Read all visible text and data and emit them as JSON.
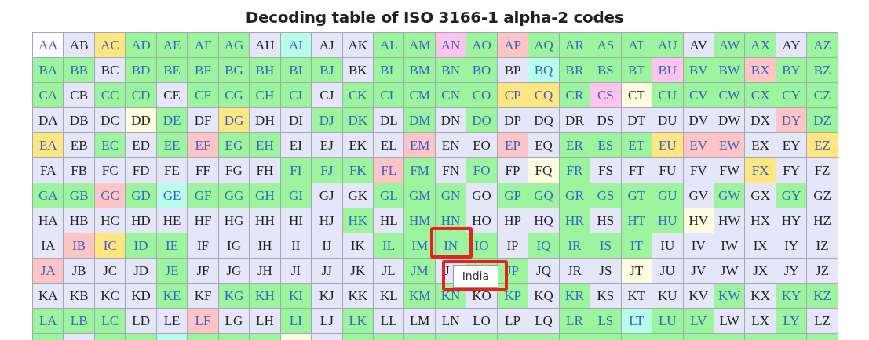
{
  "title": "Decoding table of ISO 3166-1 alpha-2 codes",
  "rows": [
    {
      "cells": [
        {
          "code": "AA",
          "kind": "w"
        },
        {
          "code": "AB",
          "kind": "u"
        },
        {
          "code": "AC",
          "kind": "y"
        },
        {
          "code": "AD",
          "kind": "g"
        },
        {
          "code": "AE",
          "kind": "g"
        },
        {
          "code": "AF",
          "kind": "g"
        },
        {
          "code": "AG",
          "kind": "g"
        },
        {
          "code": "AH",
          "kind": "u"
        },
        {
          "code": "AI",
          "kind": "c"
        },
        {
          "code": "AJ",
          "kind": "u"
        },
        {
          "code": "AK",
          "kind": "u"
        },
        {
          "code": "AL",
          "kind": "g"
        },
        {
          "code": "AM",
          "kind": "g"
        },
        {
          "code": "AN",
          "kind": "m"
        },
        {
          "code": "AO",
          "kind": "g"
        },
        {
          "code": "AP",
          "kind": "p"
        },
        {
          "code": "AQ",
          "kind": "g"
        },
        {
          "code": "AR",
          "kind": "g"
        },
        {
          "code": "AS",
          "kind": "g"
        },
        {
          "code": "AT",
          "kind": "g"
        },
        {
          "code": "AU",
          "kind": "g"
        },
        {
          "code": "AV",
          "kind": "u"
        },
        {
          "code": "AW",
          "kind": "g"
        },
        {
          "code": "AX",
          "kind": "g"
        },
        {
          "code": "AY",
          "kind": "u"
        },
        {
          "code": "AZ",
          "kind": "g"
        }
      ]
    },
    {
      "cells": [
        {
          "code": "BA",
          "kind": "g"
        },
        {
          "code": "BB",
          "kind": "g"
        },
        {
          "code": "BC",
          "kind": "u"
        },
        {
          "code": "BD",
          "kind": "g"
        },
        {
          "code": "BE",
          "kind": "g"
        },
        {
          "code": "BF",
          "kind": "g"
        },
        {
          "code": "BG",
          "kind": "g"
        },
        {
          "code": "BH",
          "kind": "g"
        },
        {
          "code": "BI",
          "kind": "g"
        },
        {
          "code": "BJ",
          "kind": "g"
        },
        {
          "code": "BK",
          "kind": "u"
        },
        {
          "code": "BL",
          "kind": "g"
        },
        {
          "code": "BM",
          "kind": "g"
        },
        {
          "code": "BN",
          "kind": "g"
        },
        {
          "code": "BO",
          "kind": "g"
        },
        {
          "code": "BP",
          "kind": "u"
        },
        {
          "code": "BQ",
          "kind": "c"
        },
        {
          "code": "BR",
          "kind": "g"
        },
        {
          "code": "BS",
          "kind": "g"
        },
        {
          "code": "BT",
          "kind": "g"
        },
        {
          "code": "BU",
          "kind": "m"
        },
        {
          "code": "BV",
          "kind": "g"
        },
        {
          "code": "BW",
          "kind": "g"
        },
        {
          "code": "BX",
          "kind": "p"
        },
        {
          "code": "BY",
          "kind": "g"
        },
        {
          "code": "BZ",
          "kind": "g"
        }
      ]
    },
    {
      "cells": [
        {
          "code": "CA",
          "kind": "g"
        },
        {
          "code": "CB",
          "kind": "u"
        },
        {
          "code": "CC",
          "kind": "g"
        },
        {
          "code": "CD",
          "kind": "g"
        },
        {
          "code": "CE",
          "kind": "u"
        },
        {
          "code": "CF",
          "kind": "g"
        },
        {
          "code": "CG",
          "kind": "g"
        },
        {
          "code": "CH",
          "kind": "g"
        },
        {
          "code": "CI",
          "kind": "g"
        },
        {
          "code": "CJ",
          "kind": "u"
        },
        {
          "code": "CK",
          "kind": "g"
        },
        {
          "code": "CL",
          "kind": "g"
        },
        {
          "code": "CM",
          "kind": "g"
        },
        {
          "code": "CN",
          "kind": "g"
        },
        {
          "code": "CO",
          "kind": "g"
        },
        {
          "code": "CP",
          "kind": "y"
        },
        {
          "code": "CQ",
          "kind": "y"
        },
        {
          "code": "CR",
          "kind": "g"
        },
        {
          "code": "CS",
          "kind": "m"
        },
        {
          "code": "CT",
          "kind": "l"
        },
        {
          "code": "CU",
          "kind": "g"
        },
        {
          "code": "CV",
          "kind": "g"
        },
        {
          "code": "CW",
          "kind": "g"
        },
        {
          "code": "CX",
          "kind": "g"
        },
        {
          "code": "CY",
          "kind": "g"
        },
        {
          "code": "CZ",
          "kind": "g"
        }
      ]
    },
    {
      "cells": [
        {
          "code": "DA",
          "kind": "u"
        },
        {
          "code": "DB",
          "kind": "u"
        },
        {
          "code": "DC",
          "kind": "u"
        },
        {
          "code": "DD",
          "kind": "l"
        },
        {
          "code": "DE",
          "kind": "g"
        },
        {
          "code": "DF",
          "kind": "u"
        },
        {
          "code": "DG",
          "kind": "y"
        },
        {
          "code": "DH",
          "kind": "u"
        },
        {
          "code": "DI",
          "kind": "u"
        },
        {
          "code": "DJ",
          "kind": "g"
        },
        {
          "code": "DK",
          "kind": "g"
        },
        {
          "code": "DL",
          "kind": "u"
        },
        {
          "code": "DM",
          "kind": "g"
        },
        {
          "code": "DN",
          "kind": "u"
        },
        {
          "code": "DO",
          "kind": "g"
        },
        {
          "code": "DP",
          "kind": "u"
        },
        {
          "code": "DQ",
          "kind": "u"
        },
        {
          "code": "DR",
          "kind": "u"
        },
        {
          "code": "DS",
          "kind": "u"
        },
        {
          "code": "DT",
          "kind": "u"
        },
        {
          "code": "DU",
          "kind": "u"
        },
        {
          "code": "DV",
          "kind": "u"
        },
        {
          "code": "DW",
          "kind": "u"
        },
        {
          "code": "DX",
          "kind": "u"
        },
        {
          "code": "DY",
          "kind": "p"
        },
        {
          "code": "DZ",
          "kind": "g"
        }
      ]
    },
    {
      "cells": [
        {
          "code": "EA",
          "kind": "y"
        },
        {
          "code": "EB",
          "kind": "u"
        },
        {
          "code": "EC",
          "kind": "g"
        },
        {
          "code": "ED",
          "kind": "u"
        },
        {
          "code": "EE",
          "kind": "g"
        },
        {
          "code": "EF",
          "kind": "p"
        },
        {
          "code": "EG",
          "kind": "g"
        },
        {
          "code": "EH",
          "kind": "g"
        },
        {
          "code": "EI",
          "kind": "u"
        },
        {
          "code": "EJ",
          "kind": "u"
        },
        {
          "code": "EK",
          "kind": "u"
        },
        {
          "code": "EL",
          "kind": "u"
        },
        {
          "code": "EM",
          "kind": "p"
        },
        {
          "code": "EN",
          "kind": "u"
        },
        {
          "code": "EO",
          "kind": "u"
        },
        {
          "code": "EP",
          "kind": "p"
        },
        {
          "code": "EQ",
          "kind": "u"
        },
        {
          "code": "ER",
          "kind": "g"
        },
        {
          "code": "ES",
          "kind": "g"
        },
        {
          "code": "ET",
          "kind": "g"
        },
        {
          "code": "EU",
          "kind": "y"
        },
        {
          "code": "EV",
          "kind": "p"
        },
        {
          "code": "EW",
          "kind": "p"
        },
        {
          "code": "EX",
          "kind": "u"
        },
        {
          "code": "EY",
          "kind": "u"
        },
        {
          "code": "EZ",
          "kind": "y"
        }
      ]
    },
    {
      "cells": [
        {
          "code": "FA",
          "kind": "u"
        },
        {
          "code": "FB",
          "kind": "u"
        },
        {
          "code": "FC",
          "kind": "u"
        },
        {
          "code": "FD",
          "kind": "u"
        },
        {
          "code": "FE",
          "kind": "u"
        },
        {
          "code": "FF",
          "kind": "u"
        },
        {
          "code": "FG",
          "kind": "u"
        },
        {
          "code": "FH",
          "kind": "u"
        },
        {
          "code": "FI",
          "kind": "g"
        },
        {
          "code": "FJ",
          "kind": "g"
        },
        {
          "code": "FK",
          "kind": "g"
        },
        {
          "code": "FL",
          "kind": "p"
        },
        {
          "code": "FM",
          "kind": "g"
        },
        {
          "code": "FN",
          "kind": "u"
        },
        {
          "code": "FO",
          "kind": "g"
        },
        {
          "code": "FP",
          "kind": "u"
        },
        {
          "code": "FQ",
          "kind": "l"
        },
        {
          "code": "FR",
          "kind": "g"
        },
        {
          "code": "FS",
          "kind": "u"
        },
        {
          "code": "FT",
          "kind": "u"
        },
        {
          "code": "FU",
          "kind": "u"
        },
        {
          "code": "FV",
          "kind": "u"
        },
        {
          "code": "FW",
          "kind": "u"
        },
        {
          "code": "FX",
          "kind": "y"
        },
        {
          "code": "FY",
          "kind": "u"
        },
        {
          "code": "FZ",
          "kind": "u"
        }
      ]
    },
    {
      "cells": [
        {
          "code": "GA",
          "kind": "g"
        },
        {
          "code": "GB",
          "kind": "g"
        },
        {
          "code": "GC",
          "kind": "p"
        },
        {
          "code": "GD",
          "kind": "g"
        },
        {
          "code": "GE",
          "kind": "c"
        },
        {
          "code": "GF",
          "kind": "g"
        },
        {
          "code": "GG",
          "kind": "g"
        },
        {
          "code": "GH",
          "kind": "g"
        },
        {
          "code": "GI",
          "kind": "g"
        },
        {
          "code": "GJ",
          "kind": "u"
        },
        {
          "code": "GK",
          "kind": "u"
        },
        {
          "code": "GL",
          "kind": "g"
        },
        {
          "code": "GM",
          "kind": "g"
        },
        {
          "code": "GN",
          "kind": "g"
        },
        {
          "code": "GO",
          "kind": "u"
        },
        {
          "code": "GP",
          "kind": "g"
        },
        {
          "code": "GQ",
          "kind": "g"
        },
        {
          "code": "GR",
          "kind": "g"
        },
        {
          "code": "GS",
          "kind": "g"
        },
        {
          "code": "GT",
          "kind": "g"
        },
        {
          "code": "GU",
          "kind": "g"
        },
        {
          "code": "GV",
          "kind": "u"
        },
        {
          "code": "GW",
          "kind": "g"
        },
        {
          "code": "GX",
          "kind": "u"
        },
        {
          "code": "GY",
          "kind": "g"
        },
        {
          "code": "GZ",
          "kind": "u"
        }
      ]
    },
    {
      "cells": [
        {
          "code": "HA",
          "kind": "u"
        },
        {
          "code": "HB",
          "kind": "u"
        },
        {
          "code": "HC",
          "kind": "u"
        },
        {
          "code": "HD",
          "kind": "u"
        },
        {
          "code": "HE",
          "kind": "u"
        },
        {
          "code": "HF",
          "kind": "u"
        },
        {
          "code": "HG",
          "kind": "u"
        },
        {
          "code": "HH",
          "kind": "u"
        },
        {
          "code": "HI",
          "kind": "u"
        },
        {
          "code": "HJ",
          "kind": "u"
        },
        {
          "code": "HK",
          "kind": "g"
        },
        {
          "code": "HL",
          "kind": "u"
        },
        {
          "code": "HM",
          "kind": "g"
        },
        {
          "code": "HN",
          "kind": "g"
        },
        {
          "code": "HO",
          "kind": "u"
        },
        {
          "code": "HP",
          "kind": "u"
        },
        {
          "code": "HQ",
          "kind": "u"
        },
        {
          "code": "HR",
          "kind": "g"
        },
        {
          "code": "HS",
          "kind": "u"
        },
        {
          "code": "HT",
          "kind": "g"
        },
        {
          "code": "HU",
          "kind": "g"
        },
        {
          "code": "HV",
          "kind": "l"
        },
        {
          "code": "HW",
          "kind": "u"
        },
        {
          "code": "HX",
          "kind": "u"
        },
        {
          "code": "HY",
          "kind": "u"
        },
        {
          "code": "HZ",
          "kind": "u"
        }
      ]
    },
    {
      "cells": [
        {
          "code": "IA",
          "kind": "u"
        },
        {
          "code": "IB",
          "kind": "p"
        },
        {
          "code": "IC",
          "kind": "y"
        },
        {
          "code": "ID",
          "kind": "g"
        },
        {
          "code": "IE",
          "kind": "g"
        },
        {
          "code": "IF",
          "kind": "u"
        },
        {
          "code": "IG",
          "kind": "u"
        },
        {
          "code": "IH",
          "kind": "u"
        },
        {
          "code": "II",
          "kind": "u"
        },
        {
          "code": "IJ",
          "kind": "u"
        },
        {
          "code": "IK",
          "kind": "u"
        },
        {
          "code": "IL",
          "kind": "g"
        },
        {
          "code": "IM",
          "kind": "g"
        },
        {
          "code": "IN",
          "kind": "g",
          "annotated": true,
          "tooltip": "India"
        },
        {
          "code": "IO",
          "kind": "g"
        },
        {
          "code": "IP",
          "kind": "u"
        },
        {
          "code": "IQ",
          "kind": "g"
        },
        {
          "code": "IR",
          "kind": "g"
        },
        {
          "code": "IS",
          "kind": "g"
        },
        {
          "code": "IT",
          "kind": "g"
        },
        {
          "code": "IU",
          "kind": "u"
        },
        {
          "code": "IV",
          "kind": "u"
        },
        {
          "code": "IW",
          "kind": "u"
        },
        {
          "code": "IX",
          "kind": "u"
        },
        {
          "code": "IY",
          "kind": "u"
        },
        {
          "code": "IZ",
          "kind": "u"
        }
      ]
    },
    {
      "cells": [
        {
          "code": "JA",
          "kind": "p"
        },
        {
          "code": "JB",
          "kind": "u"
        },
        {
          "code": "JC",
          "kind": "u"
        },
        {
          "code": "JD",
          "kind": "u"
        },
        {
          "code": "JE",
          "kind": "g"
        },
        {
          "code": "JF",
          "kind": "u"
        },
        {
          "code": "JG",
          "kind": "u"
        },
        {
          "code": "JH",
          "kind": "u"
        },
        {
          "code": "JI",
          "kind": "u"
        },
        {
          "code": "JJ",
          "kind": "u"
        },
        {
          "code": "JK",
          "kind": "u"
        },
        {
          "code": "JL",
          "kind": "u"
        },
        {
          "code": "JM",
          "kind": "g"
        },
        {
          "code": "J",
          "kind": "u",
          "partial": true
        },
        {
          "kind": "g"
        },
        {
          "code": "JP",
          "kind": "g"
        },
        {
          "code": "JQ",
          "kind": "u"
        },
        {
          "code": "JR",
          "kind": "u"
        },
        {
          "code": "JS",
          "kind": "u"
        },
        {
          "code": "JT",
          "kind": "l"
        },
        {
          "code": "JU",
          "kind": "u"
        },
        {
          "code": "JV",
          "kind": "u"
        },
        {
          "code": "JW",
          "kind": "u"
        },
        {
          "code": "JX",
          "kind": "u"
        },
        {
          "code": "JY",
          "kind": "u"
        },
        {
          "code": "JZ",
          "kind": "u"
        }
      ]
    },
    {
      "cells": [
        {
          "code": "KA",
          "kind": "u"
        },
        {
          "code": "KB",
          "kind": "u"
        },
        {
          "code": "KC",
          "kind": "u"
        },
        {
          "code": "KD",
          "kind": "u"
        },
        {
          "code": "KE",
          "kind": "g"
        },
        {
          "code": "KF",
          "kind": "u"
        },
        {
          "code": "KG",
          "kind": "g"
        },
        {
          "code": "KH",
          "kind": "g"
        },
        {
          "code": "KI",
          "kind": "g"
        },
        {
          "code": "KJ",
          "kind": "u"
        },
        {
          "code": "KK",
          "kind": "u"
        },
        {
          "code": "KL",
          "kind": "u"
        },
        {
          "code": "KM",
          "kind": "g"
        },
        {
          "code": "KN",
          "kind": "g"
        },
        {
          "code": "KO",
          "kind": "u"
        },
        {
          "code": "KP",
          "kind": "g"
        },
        {
          "code": "KQ",
          "kind": "u"
        },
        {
          "code": "KR",
          "kind": "g"
        },
        {
          "code": "KS",
          "kind": "u"
        },
        {
          "code": "KT",
          "kind": "u"
        },
        {
          "code": "KU",
          "kind": "u"
        },
        {
          "code": "KV",
          "kind": "u"
        },
        {
          "code": "KW",
          "kind": "g"
        },
        {
          "code": "KX",
          "kind": "u"
        },
        {
          "code": "KY",
          "kind": "g"
        },
        {
          "code": "KZ",
          "kind": "g"
        }
      ]
    },
    {
      "cells": [
        {
          "code": "LA",
          "kind": "g"
        },
        {
          "code": "LB",
          "kind": "g"
        },
        {
          "code": "LC",
          "kind": "g"
        },
        {
          "code": "LD",
          "kind": "u"
        },
        {
          "code": "LE",
          "kind": "u"
        },
        {
          "code": "LF",
          "kind": "p"
        },
        {
          "code": "LG",
          "kind": "u"
        },
        {
          "code": "LH",
          "kind": "u"
        },
        {
          "code": "LI",
          "kind": "g"
        },
        {
          "code": "LJ",
          "kind": "u"
        },
        {
          "code": "LK",
          "kind": "g"
        },
        {
          "code": "LL",
          "kind": "u"
        },
        {
          "code": "LM",
          "kind": "u"
        },
        {
          "code": "LN",
          "kind": "u"
        },
        {
          "code": "LO",
          "kind": "u"
        },
        {
          "code": "LP",
          "kind": "u"
        },
        {
          "code": "LQ",
          "kind": "u"
        },
        {
          "code": "LR",
          "kind": "g"
        },
        {
          "code": "LS",
          "kind": "g"
        },
        {
          "code": "LT",
          "kind": "c"
        },
        {
          "code": "LU",
          "kind": "g"
        },
        {
          "code": "LV",
          "kind": "g"
        },
        {
          "code": "LW",
          "kind": "u"
        },
        {
          "code": "LX",
          "kind": "u"
        },
        {
          "code": "LY",
          "kind": "g"
        },
        {
          "code": "LZ",
          "kind": "u"
        }
      ]
    },
    {
      "cells": [
        {
          "kind": "g"
        },
        {
          "kind": "u"
        },
        {
          "kind": "g"
        },
        {
          "kind": "g"
        },
        {
          "kind": "c"
        },
        {
          "kind": "g"
        },
        {
          "kind": "g"
        },
        {
          "kind": "g"
        },
        {
          "kind": "l"
        },
        {
          "kind": "u"
        },
        {
          "kind": "g"
        },
        {
          "kind": "g"
        },
        {
          "kind": "g"
        },
        {
          "kind": "g"
        },
        {
          "kind": "g"
        },
        {
          "kind": "g"
        },
        {
          "kind": "g"
        },
        {
          "kind": "g"
        },
        {
          "kind": "g"
        },
        {
          "kind": "g"
        },
        {
          "kind": "g"
        },
        {
          "kind": "g"
        },
        {
          "kind": "g"
        },
        {
          "kind": "g"
        },
        {
          "kind": "g"
        },
        {
          "kind": "g"
        }
      ]
    }
  ]
}
